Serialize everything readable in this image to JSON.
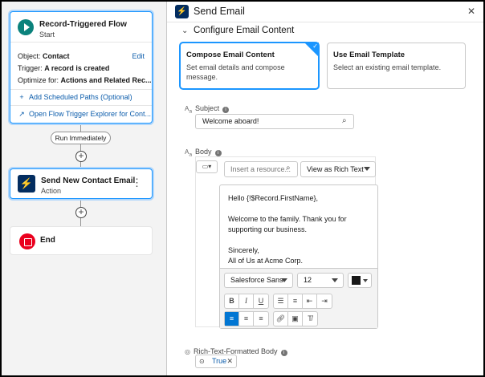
{
  "flow": {
    "start": {
      "title": "Record-Triggered Flow",
      "subtitle": "Start",
      "object_label": "Object:",
      "object_value": "Contact",
      "edit_label": "Edit",
      "trigger_label": "Trigger:",
      "trigger_value": "A record is created",
      "optimize_label": "Optimize for:",
      "optimize_value": "Actions and Related Rec...",
      "add_paths_label": "Add Scheduled Paths (Optional)",
      "explorer_label": "Open Flow Trigger Explorer for Cont..."
    },
    "run_label": "Run Immediately",
    "action": {
      "title": "Send New Contact Email",
      "subtitle": "Action"
    },
    "end": {
      "title": "End"
    }
  },
  "panel": {
    "title": "Send Email",
    "section_title": "Configure Email Content",
    "tiles": [
      {
        "title": "Compose Email Content",
        "desc": "Set email details and compose message."
      },
      {
        "title": "Use Email Template",
        "desc": "Select an existing email template."
      }
    ],
    "subject": {
      "label": "Subject",
      "value": "Welcome aboard!"
    },
    "body": {
      "label": "Body",
      "resource_placeholder": "Insert a resource...",
      "view_select": "View as Rich Text",
      "content": [
        "Hello {!$Record.FirstName},",
        "Welcome to the family. Thank you for supporting our business.",
        "Sincerely,\nAll of Us at Acme Corp."
      ],
      "font": "Salesforce Sans",
      "size": "12"
    },
    "rich_text_flag": {
      "label": "Rich-Text-Formatted Body",
      "value": "True"
    }
  },
  "colors": {
    "brand_blue": "#0176d3",
    "selection_blue": "#1b96ff",
    "start_teal": "#0b827c",
    "action_navy": "#032d60",
    "end_red": "#ea001e"
  }
}
